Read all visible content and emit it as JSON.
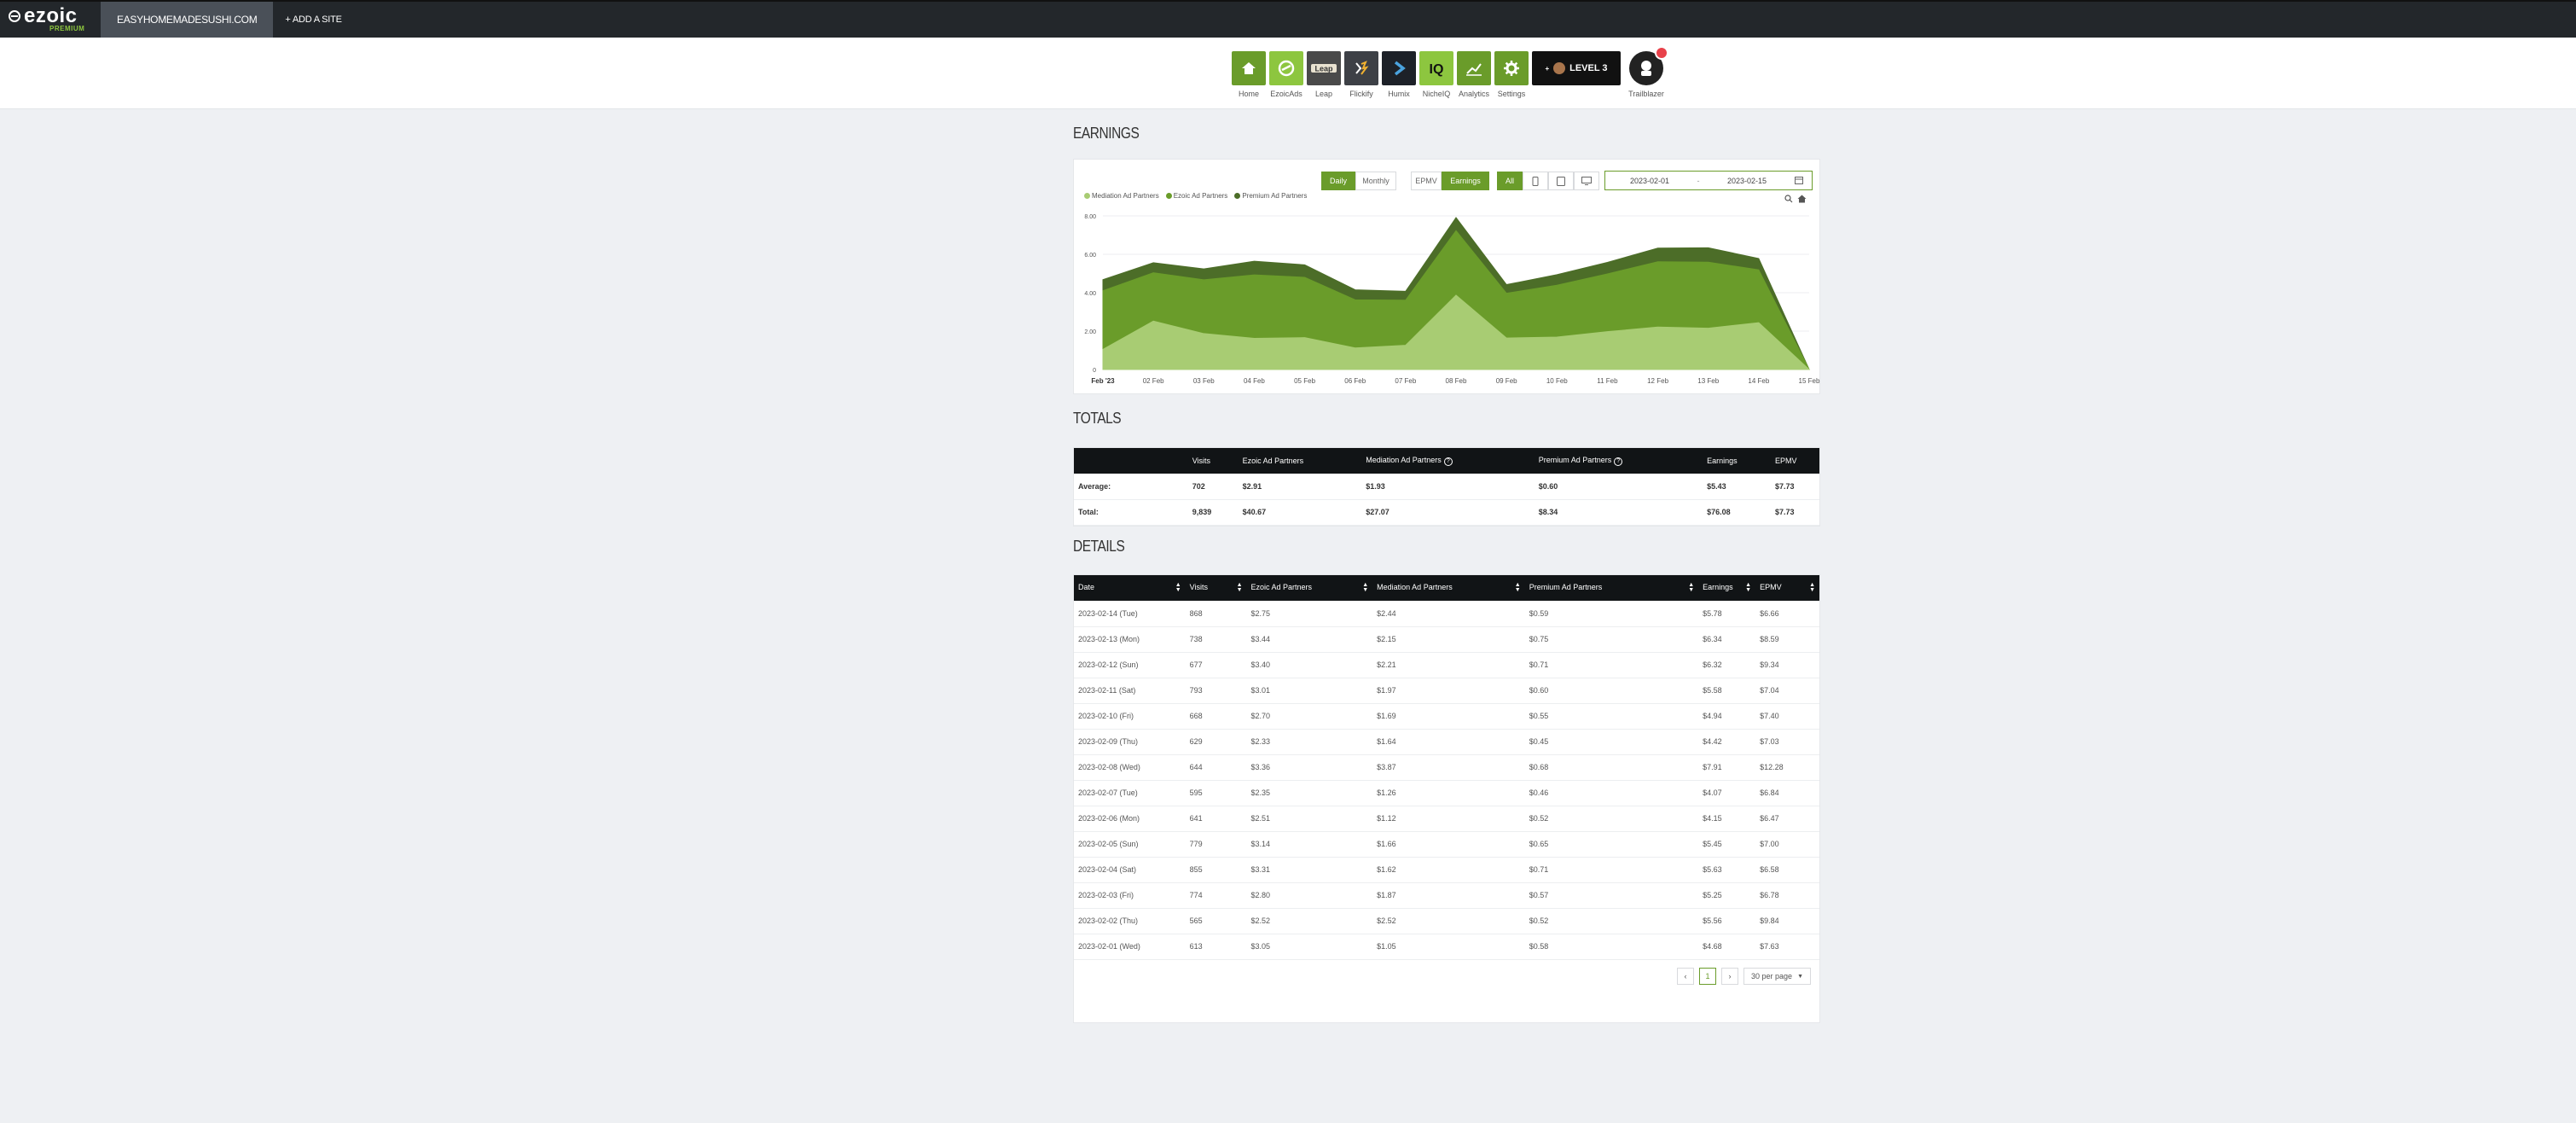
{
  "topbar": {
    "logo": "ezoic",
    "logo_sub": "PREMIUM",
    "site": "EASYHOMEMADESUSHI.COM",
    "add_site": "+ ADD A SITE"
  },
  "apps": [
    {
      "label": "Home",
      "icon": "home-icon",
      "color": "#6a9c2a"
    },
    {
      "label": "EzoicAds",
      "icon": "ezoicads-icon",
      "color": "#8dc63f"
    },
    {
      "label": "Leap",
      "icon": "leap-icon",
      "color": "#4a4a4a"
    },
    {
      "label": "Flickify",
      "icon": "flickify-icon",
      "color": "#3d4046"
    },
    {
      "label": "Humix",
      "icon": "humix-icon",
      "color": "#1d2128"
    },
    {
      "label": "NicheIQ",
      "icon": "nicheiq-icon",
      "color": "#8dc63f"
    },
    {
      "label": "Analytics",
      "icon": "analytics-icon",
      "color": "#6a9c2a"
    },
    {
      "label": "Settings",
      "icon": "settings-icon",
      "color": "#6a9c2a"
    }
  ],
  "level": {
    "text": "LEVEL 3"
  },
  "trailblazer": {
    "label": "Trailblazer"
  },
  "earnings": {
    "title": "EARNINGS",
    "period_buttons": [
      "Daily",
      "Monthly"
    ],
    "metric_buttons": [
      "EPMV",
      "Earnings"
    ],
    "filter_buttons": [
      "All"
    ],
    "date_from": "2023-02-01",
    "date_sep": "-",
    "date_to": "2023-02-15",
    "legend": [
      "Mediation Ad Partners",
      "Ezoic Ad Partners",
      "Premium Ad Partners"
    ]
  },
  "chart_data": {
    "type": "area",
    "stacked": true,
    "categories": [
      "Feb '23",
      "02 Feb",
      "03 Feb",
      "04 Feb",
      "05 Feb",
      "06 Feb",
      "07 Feb",
      "08 Feb",
      "09 Feb",
      "10 Feb",
      "11 Feb",
      "12 Feb",
      "13 Feb",
      "14 Feb",
      "15 Feb"
    ],
    "y_ticks": [
      "0",
      "2.00",
      "4.00",
      "6.00",
      "8.00"
    ],
    "ylim": [
      0,
      8
    ],
    "series": [
      {
        "name": "Mediation Ad Partners",
        "color": "#a8cc73",
        "values": [
          1.05,
          2.52,
          1.87,
          1.62,
          1.66,
          1.12,
          1.26,
          3.87,
          1.64,
          1.69,
          1.97,
          2.21,
          2.15,
          2.44,
          0
        ]
      },
      {
        "name": "Ezoic Ad Partners",
        "color": "#6a9c2a",
        "values": [
          3.05,
          2.52,
          2.8,
          3.31,
          3.14,
          2.51,
          2.35,
          3.36,
          2.33,
          2.7,
          3.01,
          3.4,
          3.44,
          2.75,
          0
        ]
      },
      {
        "name": "Premium Ad Partners",
        "color": "#4c6d28",
        "values": [
          0.58,
          0.52,
          0.57,
          0.71,
          0.65,
          0.52,
          0.46,
          0.68,
          0.45,
          0.55,
          0.6,
          0.71,
          0.75,
          0.59,
          0
        ]
      }
    ]
  },
  "totals": {
    "title": "TOTALS",
    "headers": [
      "",
      "Visits",
      "Ezoic Ad Partners",
      "Mediation Ad Partners",
      "Premium Ad Partners",
      "Earnings",
      "EPMV"
    ],
    "rows": [
      [
        "Average:",
        "702",
        "$2.91",
        "$1.93",
        "$0.60",
        "$5.43",
        "$7.73"
      ],
      [
        "Total:",
        "9,839",
        "$40.67",
        "$27.07",
        "$8.34",
        "$76.08",
        "$7.73"
      ]
    ]
  },
  "details": {
    "title": "DETAILS",
    "headers": [
      "Date",
      "Visits",
      "Ezoic Ad Partners",
      "Mediation Ad Partners",
      "Premium Ad Partners",
      "Earnings",
      "EPMV"
    ],
    "rows": [
      [
        "2023-02-14 (Tue)",
        "868",
        "$2.75",
        "$2.44",
        "$0.59",
        "$5.78",
        "$6.66"
      ],
      [
        "2023-02-13 (Mon)",
        "738",
        "$3.44",
        "$2.15",
        "$0.75",
        "$6.34",
        "$8.59"
      ],
      [
        "2023-02-12 (Sun)",
        "677",
        "$3.40",
        "$2.21",
        "$0.71",
        "$6.32",
        "$9.34"
      ],
      [
        "2023-02-11 (Sat)",
        "793",
        "$3.01",
        "$1.97",
        "$0.60",
        "$5.58",
        "$7.04"
      ],
      [
        "2023-02-10 (Fri)",
        "668",
        "$2.70",
        "$1.69",
        "$0.55",
        "$4.94",
        "$7.40"
      ],
      [
        "2023-02-09 (Thu)",
        "629",
        "$2.33",
        "$1.64",
        "$0.45",
        "$4.42",
        "$7.03"
      ],
      [
        "2023-02-08 (Wed)",
        "644",
        "$3.36",
        "$3.87",
        "$0.68",
        "$7.91",
        "$12.28"
      ],
      [
        "2023-02-07 (Tue)",
        "595",
        "$2.35",
        "$1.26",
        "$0.46",
        "$4.07",
        "$6.84"
      ],
      [
        "2023-02-06 (Mon)",
        "641",
        "$2.51",
        "$1.12",
        "$0.52",
        "$4.15",
        "$6.47"
      ],
      [
        "2023-02-05 (Sun)",
        "779",
        "$3.14",
        "$1.66",
        "$0.65",
        "$5.45",
        "$7.00"
      ],
      [
        "2023-02-04 (Sat)",
        "855",
        "$3.31",
        "$1.62",
        "$0.71",
        "$5.63",
        "$6.58"
      ],
      [
        "2023-02-03 (Fri)",
        "774",
        "$2.80",
        "$1.87",
        "$0.57",
        "$5.25",
        "$6.78"
      ],
      [
        "2023-02-02 (Thu)",
        "565",
        "$2.52",
        "$2.52",
        "$0.52",
        "$5.56",
        "$9.84"
      ],
      [
        "2023-02-01 (Wed)",
        "613",
        "$3.05",
        "$1.05",
        "$0.58",
        "$4.68",
        "$7.63"
      ]
    ]
  },
  "pagination": {
    "prev": "‹",
    "page": "1",
    "next": "›",
    "per_page": "30 per page"
  },
  "colors": {
    "accent": "#6a9c2a",
    "light": "#8dc63f",
    "topbar": "#23272b"
  }
}
